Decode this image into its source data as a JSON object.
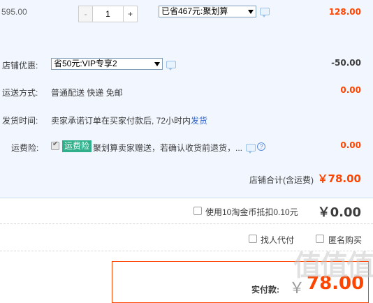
{
  "item": {
    "unit_price": "595.00",
    "qty_minus": "-",
    "qty_value": "1",
    "qty_plus": "+",
    "promo_select": "已省467元:聚划算",
    "subtotal": "128.00"
  },
  "shop_discount": {
    "label": "店铺优惠:",
    "select": "省50元:VIP专享2",
    "amount": "-50.00"
  },
  "shipping": {
    "label": "运送方式:",
    "value": "普通配送 快递 免邮",
    "amount": "0.00"
  },
  "delivery": {
    "label": "发货时间:",
    "text": "卖家承诺订单在买家付款后, 72小时内",
    "link": "发货"
  },
  "insurance": {
    "label": "运费险:",
    "badge": "运费险",
    "text": "聚划算卖家赠送，若确认收货前退货，...",
    "help": "?",
    "amount": "0.00"
  },
  "shop_total": {
    "label": "店铺合计(含运费)",
    "amount": "￥78.00"
  },
  "coins": {
    "label": "使用10淘金币抵扣0.10元",
    "amount": "￥0.00"
  },
  "options": {
    "proxy_pay": "找人代付",
    "anonymous": "匿名购买"
  },
  "pay": {
    "label": "实付款:",
    "currency": "￥",
    "amount": "78.00"
  },
  "watermark": "值值值",
  "colors": {
    "accent": "#ff4400",
    "band": "#f2f7ff",
    "badge": "#2fb08a"
  }
}
